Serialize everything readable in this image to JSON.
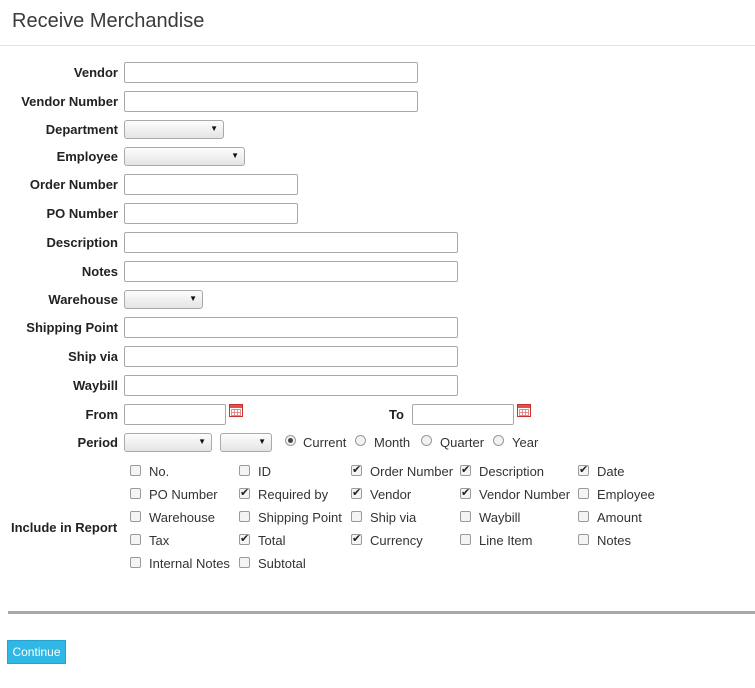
{
  "page_title": "Receive Merchandise",
  "fields": {
    "vendor": {
      "label": "Vendor",
      "value": ""
    },
    "vendor_number": {
      "label": "Vendor Number",
      "value": ""
    },
    "department": {
      "label": "Department",
      "value": ""
    },
    "employee": {
      "label": "Employee",
      "value": ""
    },
    "order_number": {
      "label": "Order Number",
      "value": ""
    },
    "po_number": {
      "label": "PO Number",
      "value": ""
    },
    "description": {
      "label": "Description",
      "value": ""
    },
    "notes": {
      "label": "Notes",
      "value": ""
    },
    "warehouse": {
      "label": "Warehouse",
      "value": ""
    },
    "shipping_point": {
      "label": "Shipping Point",
      "value": ""
    },
    "ship_via": {
      "label": "Ship via",
      "value": ""
    },
    "waybill": {
      "label": "Waybill",
      "value": ""
    },
    "from": {
      "label": "From",
      "value": ""
    },
    "to": {
      "label": "To",
      "value": ""
    }
  },
  "period": {
    "label": "Period",
    "select1": "",
    "select2": "",
    "options": [
      {
        "label": "Current",
        "selected": true
      },
      {
        "label": "Month",
        "selected": false
      },
      {
        "label": "Quarter",
        "selected": false
      },
      {
        "label": "Year",
        "selected": false
      }
    ]
  },
  "include_in_report": {
    "label": "Include in Report",
    "items": [
      {
        "label": "No.",
        "checked": false
      },
      {
        "label": "ID",
        "checked": false
      },
      {
        "label": "Order Number",
        "checked": true
      },
      {
        "label": "Description",
        "checked": true
      },
      {
        "label": "Date",
        "checked": true
      },
      {
        "label": "PO Number",
        "checked": false
      },
      {
        "label": "Required by",
        "checked": true
      },
      {
        "label": "Vendor",
        "checked": true
      },
      {
        "label": "Vendor Number",
        "checked": true
      },
      {
        "label": "Employee",
        "checked": false
      },
      {
        "label": "Warehouse",
        "checked": false
      },
      {
        "label": "Shipping Point",
        "checked": false
      },
      {
        "label": "Ship via",
        "checked": false
      },
      {
        "label": "Waybill",
        "checked": false
      },
      {
        "label": "Amount",
        "checked": false
      },
      {
        "label": "Tax",
        "checked": false
      },
      {
        "label": "Total",
        "checked": true
      },
      {
        "label": "Currency",
        "checked": true
      },
      {
        "label": "Line Item",
        "checked": false
      },
      {
        "label": "Notes",
        "checked": false
      },
      {
        "label": "Internal Notes",
        "checked": false
      },
      {
        "label": "Subtotal",
        "checked": false
      }
    ]
  },
  "continue_label": "Continue",
  "icons": {
    "calendar": "calendar-icon",
    "dropdown": "chevron-down-icon"
  },
  "colors": {
    "button": "#2fb7e6",
    "calendar": "#d9534f"
  }
}
